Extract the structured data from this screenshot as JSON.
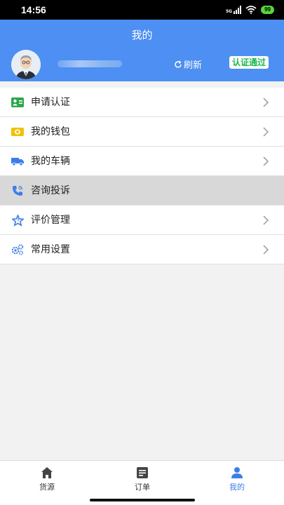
{
  "status_bar": {
    "time": "14:56",
    "network": "5G",
    "battery": "99"
  },
  "header": {
    "title": "我的",
    "refresh_label": "刷新",
    "cert_status": "认证通过"
  },
  "menu": [
    {
      "label": "申请认证",
      "icon": "id-card-icon",
      "color": "#2aa84a",
      "active": false
    },
    {
      "label": "我的钱包",
      "icon": "wallet-icon",
      "color": "#f2c200",
      "active": false
    },
    {
      "label": "我的车辆",
      "icon": "truck-icon",
      "color": "#3d7de8",
      "active": false
    },
    {
      "label": "咨询投诉",
      "icon": "phone-icon",
      "color": "#3d7de8",
      "active": true
    },
    {
      "label": "评价管理",
      "icon": "star-icon",
      "color": "#3d7de8",
      "active": false
    },
    {
      "label": "常用设置",
      "icon": "gears-icon",
      "color": "#3d7de8",
      "active": false
    }
  ],
  "tabbar": {
    "tabs": [
      {
        "label": "货源",
        "icon": "home-icon",
        "active": false
      },
      {
        "label": "订单",
        "icon": "order-icon",
        "active": false
      },
      {
        "label": "我的",
        "icon": "user-icon",
        "active": true
      }
    ]
  },
  "colors": {
    "header_bg": "#4d8ff2",
    "accent": "#3d7de8",
    "badge_text": "#1cb84b"
  }
}
